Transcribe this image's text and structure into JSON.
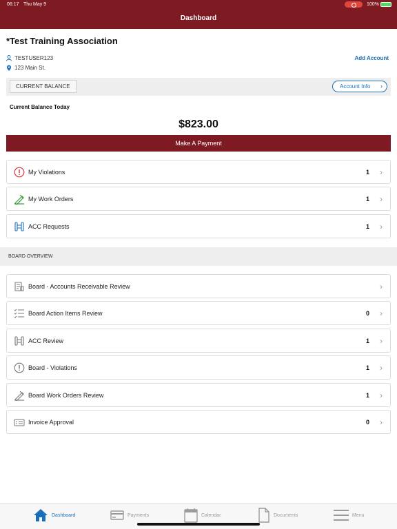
{
  "status_bar": {
    "time": "06:17",
    "date": "Thu May 9",
    "battery": "100%"
  },
  "header": {
    "title": "Dashboard"
  },
  "account": {
    "name": "*Test Training Association",
    "user": "TESTUSER123",
    "address": "123 Main St.",
    "add_account": "Add Account"
  },
  "balance": {
    "label": "CURRENT BALANCE",
    "account_info": "Account Info",
    "today_label": "Current Balance Today",
    "amount": "$823.00",
    "pay_button": "Make A Payment"
  },
  "my_items": [
    {
      "label": "My Violations",
      "count": "1",
      "icon": "violations-icon"
    },
    {
      "label": "My Work Orders",
      "count": "1",
      "icon": "work-orders-icon"
    },
    {
      "label": "ACC Requests",
      "count": "1",
      "icon": "acc-icon"
    }
  ],
  "board": {
    "title": "BOARD OVERVIEW",
    "items": [
      {
        "label": "Board - Accounts Receivable Review",
        "count": "",
        "icon": "receivable-icon"
      },
      {
        "label": "Board Action Items Review",
        "count": "0",
        "icon": "checklist-icon"
      },
      {
        "label": "ACC Review",
        "count": "1",
        "icon": "acc-icon"
      },
      {
        "label": "Board - Violations",
        "count": "1",
        "icon": "violations-icon"
      },
      {
        "label": "Board Work Orders Review",
        "count": "1",
        "icon": "work-orders-icon"
      },
      {
        "label": "Invoice Approval",
        "count": "0",
        "icon": "invoice-icon"
      }
    ]
  },
  "tabs": [
    {
      "label": "Dashboard",
      "icon": "home-icon",
      "active": true
    },
    {
      "label": "Payments",
      "icon": "card-icon",
      "active": false
    },
    {
      "label": "Calendar",
      "icon": "calendar-icon",
      "active": false
    },
    {
      "label": "Documents",
      "icon": "document-icon",
      "active": false
    },
    {
      "label": "Menu",
      "icon": "menu-icon",
      "active": false
    }
  ],
  "colors": {
    "brand": "#7e1a22",
    "link": "#1b6fb8",
    "violation": "#d9363e",
    "work_order": "#3a9a3a",
    "acc": "#1b6fb8"
  }
}
